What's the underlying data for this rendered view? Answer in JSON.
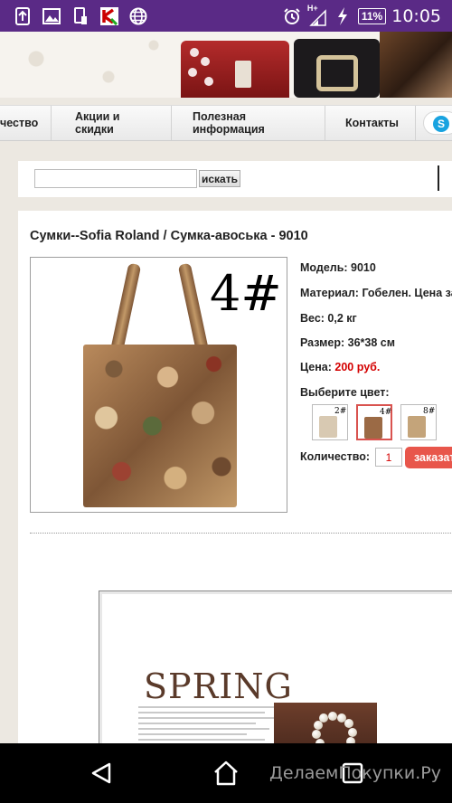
{
  "status_bar": {
    "network": "H+",
    "battery": "11%",
    "time": "10:05",
    "icons": [
      "upload-icon",
      "image-icon",
      "phone-sd-icon",
      "kaspersky-icon",
      "globe-icon",
      "alarm-icon",
      "signal-icon",
      "charging-icon",
      "battery-icon"
    ]
  },
  "nav": {
    "items": [
      {
        "label_line1": "чество",
        "label_line2": ""
      },
      {
        "label_line1": "Акции и",
        "label_line2": "скидки"
      },
      {
        "label_line1": "Полезная",
        "label_line2": "информация"
      },
      {
        "label_line1": "Контакты",
        "label_line2": ""
      }
    ],
    "skype_glyph": "S"
  },
  "search": {
    "value": "",
    "placeholder": "",
    "button_label": "искать"
  },
  "product": {
    "title": "Сумки--Sofia Roland / Сумка-авоська - 9010",
    "image_label": "4#",
    "model": "Модель: 9010",
    "material": "Материал: Гобелен. Цена за",
    "weight": "Вес: 0,2 кг",
    "size": "Размер: 36*38 см",
    "price_label": "Цена:",
    "price_value": "200 руб.",
    "choose_color": "Выберите цвет:",
    "swatches": [
      {
        "label": "2#",
        "color": "#d8c9b2"
      },
      {
        "label": "4#",
        "color": "#9b6a45"
      },
      {
        "label": "8#",
        "color": "#c4a47a"
      }
    ],
    "quantity_label": "Количество:",
    "quantity_value": "1",
    "order_button": "заказат"
  },
  "promo": {
    "heading": "SPRING"
  },
  "watermark": "ДелаемПокупки.Ру"
}
